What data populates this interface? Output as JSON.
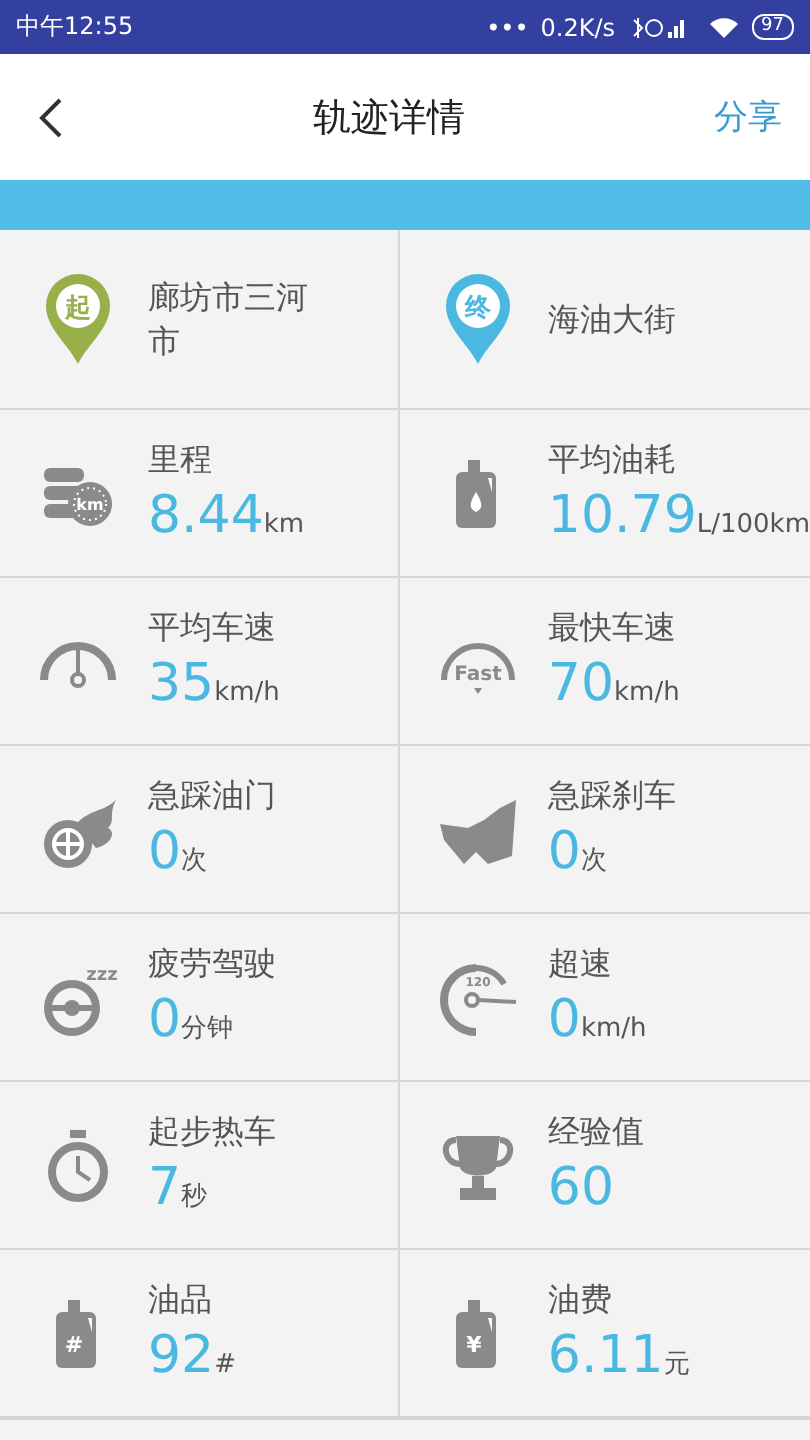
{
  "status_bar": {
    "time": "中午12:55",
    "dots": "•••",
    "speed": "0.2K/s",
    "battery": "97"
  },
  "header": {
    "title": "轨迹详情",
    "action": "分享"
  },
  "places": [
    {
      "kind": "start",
      "badge": "起",
      "name": "廊坊市三河市"
    },
    {
      "kind": "end",
      "badge": "终",
      "name": "海油大街"
    }
  ],
  "stats": [
    {
      "label": "里程",
      "value": "8.44",
      "unit": "km",
      "badge": "km"
    },
    {
      "label": "平均油耗",
      "value": "10.79",
      "unit": "L/100km"
    },
    {
      "label": "平均车速",
      "value": "35",
      "unit": "km/h"
    },
    {
      "label": "最快车速",
      "value": "70",
      "unit": "km/h",
      "badge": "Fast"
    },
    {
      "label": "急踩油门",
      "value": "0",
      "unit": "次"
    },
    {
      "label": "急踩刹车",
      "value": "0",
      "unit": "次"
    },
    {
      "label": "疲劳驾驶",
      "value": "0",
      "unit": "分钟",
      "badge": "zzz"
    },
    {
      "label": "超速",
      "value": "0",
      "unit": "km/h",
      "badge": "120"
    },
    {
      "label": "起步热车",
      "value": "7",
      "unit": "秒"
    },
    {
      "label": "经验值",
      "value": "60"
    },
    {
      "label": "油品",
      "value": "92",
      "unit": "#",
      "badge": "#"
    },
    {
      "label": "油费",
      "value": "6.11",
      "unit": "元",
      "badge": "¥"
    }
  ]
}
